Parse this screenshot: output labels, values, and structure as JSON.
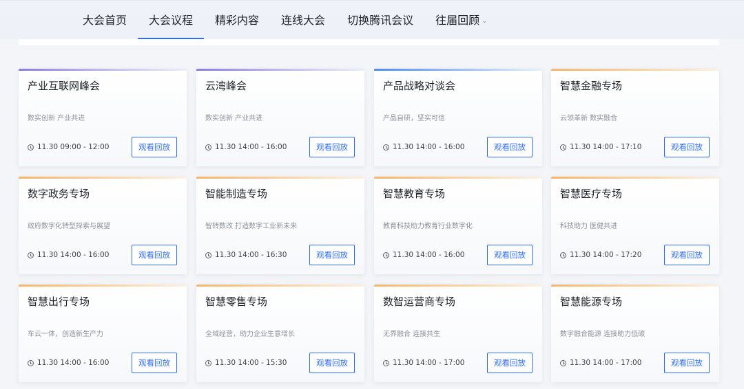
{
  "nav": {
    "items": [
      {
        "label": "大会首页",
        "active": false
      },
      {
        "label": "大会议程",
        "active": true
      },
      {
        "label": "精彩内容",
        "active": false
      },
      {
        "label": "连线大会",
        "active": false
      },
      {
        "label": "切换腾讯会议",
        "active": false
      },
      {
        "label": "往届回顾",
        "active": false,
        "dropdown": true
      }
    ]
  },
  "colors": {
    "brand": "#2f6bff",
    "accent_purple": "#8a7be6",
    "accent_blue": "#4e8cf7",
    "accent_orange": "#f5b56a"
  },
  "cards": [
    {
      "title": "产业互联网峰会",
      "subtitle": "数实创新 产业共进",
      "time": "11.30 09:00 - 12:00",
      "button": "观看回放",
      "accent": "purple"
    },
    {
      "title": "云湾峰会",
      "subtitle": "数实创新 产业共进",
      "time": "11.30 14:00 - 16:00",
      "button": "观看回放",
      "accent": "purple"
    },
    {
      "title": "产品战略对谈会",
      "subtitle": "产品自研，坚实可信",
      "time": "11.30 14:00 - 16:00",
      "button": "观看回放",
      "accent": "blue"
    },
    {
      "title": "智慧金融专场",
      "subtitle": "云领革新 数实融合",
      "time": "11.30 14:00 - 17:10",
      "button": "观看回放",
      "accent": "orange"
    },
    {
      "title": "数字政务专场",
      "subtitle": "政府数字化转型探索与展望",
      "time": "11.30 14:00 - 16:00",
      "button": "观看回放",
      "accent": "orange"
    },
    {
      "title": "智能制造专场",
      "subtitle": "智转数改 打造数字工业新未来",
      "time": "11.30 14:00 - 16:30",
      "button": "观看回放",
      "accent": "orange"
    },
    {
      "title": "智慧教育专场",
      "subtitle": "教育科技助力教育行业数字化",
      "time": "11.30 14:00 - 16:00",
      "button": "观看回放",
      "accent": "orange"
    },
    {
      "title": "智慧医疗专场",
      "subtitle": "科技助力 医健共进",
      "time": "11.30 14:00 - 17:20",
      "button": "观看回放",
      "accent": "orange"
    },
    {
      "title": "智慧出行专场",
      "subtitle": "车云一体，创造新生产力",
      "time": "11.30 14:00 - 16:00",
      "button": "观看回放",
      "accent": "orange"
    },
    {
      "title": "智慧零售专场",
      "subtitle": "全域经营，助力企业生意增长",
      "time": "11.30 14:00 - 15:30",
      "button": "观看回放",
      "accent": "orange"
    },
    {
      "title": "数智运营商专场",
      "subtitle": "无界融合 连接共生",
      "time": "11.30 14:00 - 17:00",
      "button": "观看回放",
      "accent": "orange"
    },
    {
      "title": "智慧能源专场",
      "subtitle": "数字融合能源 连接助力低碳",
      "time": "11.30 14:00 - 17:00",
      "button": "观看回放",
      "accent": "orange"
    }
  ]
}
